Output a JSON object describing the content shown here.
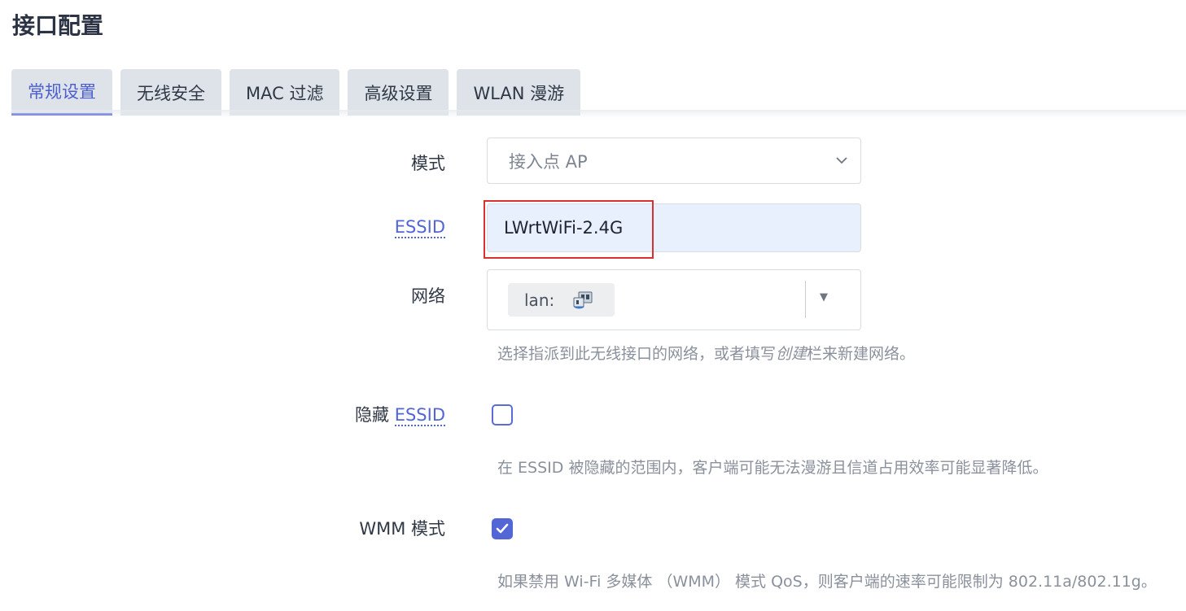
{
  "page": {
    "title": "接口配置"
  },
  "tabs": [
    {
      "label": "常规设置",
      "active": true
    },
    {
      "label": "无线安全",
      "active": false
    },
    {
      "label": "MAC 过滤",
      "active": false
    },
    {
      "label": "高级设置",
      "active": false
    },
    {
      "label": "WLAN 漫游",
      "active": false
    }
  ],
  "form": {
    "mode": {
      "label": "模式",
      "value": "接入点 AP"
    },
    "essid": {
      "label": "ESSID",
      "value": "LWrtWiFi-2.4G"
    },
    "network": {
      "label": "网络",
      "chip_label": "lan:",
      "help_before": "选择指派到此无线接口的网络，或者填写",
      "help_em": "创建",
      "help_after": "栏来新建网络。"
    },
    "hidden_essid": {
      "label_prefix": "隐藏",
      "label_link": "ESSID",
      "checked": false,
      "help": "在 ESSID 被隐藏的范围内，客户端可能无法漫游且信道占用效率可能显著降低。"
    },
    "wmm": {
      "label": "WMM 模式",
      "checked": true,
      "help": "如果禁用 Wi-Fi 多媒体 （WMM） 模式 QoS，则客户端的速率可能限制为 802.11a/802.11g。"
    }
  },
  "colors": {
    "accent": "#5266d6",
    "tab_bg": "#dde3e9",
    "highlight": "#d93030",
    "autofill_bg": "#e8f0fd"
  }
}
